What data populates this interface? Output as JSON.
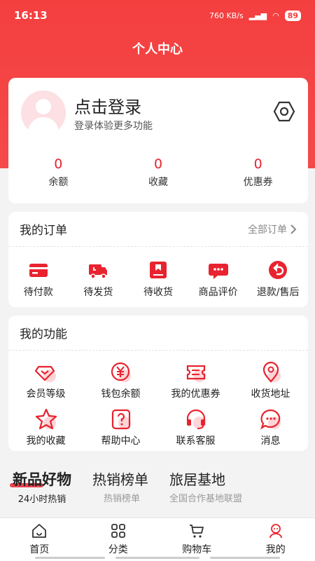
{
  "status_bar": {
    "time": "16:13",
    "net_speed": "760 KB/s",
    "battery": "89"
  },
  "page_title": "个人中心",
  "profile": {
    "login_title": "点击登录",
    "login_subtitle": "登录体验更多功能",
    "stats": [
      {
        "value": "0",
        "label": "余额"
      },
      {
        "value": "0",
        "label": "收藏"
      },
      {
        "value": "0",
        "label": "优惠券"
      }
    ]
  },
  "orders": {
    "title": "我的订单",
    "more": "全部订单",
    "items": [
      {
        "label": "待付款",
        "icon": "card-icon"
      },
      {
        "label": "待发货",
        "icon": "truck-icon"
      },
      {
        "label": "待收货",
        "icon": "box-icon"
      },
      {
        "label": "商品评价",
        "icon": "comment-icon"
      },
      {
        "label": "退款/售后",
        "icon": "return-icon"
      }
    ]
  },
  "functions": {
    "title": "我的功能",
    "items": [
      {
        "label": "会员等级",
        "icon": "diamond-icon"
      },
      {
        "label": "钱包余额",
        "icon": "yen-icon"
      },
      {
        "label": "我的优惠券",
        "icon": "coupon-icon"
      },
      {
        "label": "收货地址",
        "icon": "location-icon"
      },
      {
        "label": "我的收藏",
        "icon": "star-icon"
      },
      {
        "label": "帮助中心",
        "icon": "help-icon"
      },
      {
        "label": "联系客服",
        "icon": "headset-icon"
      },
      {
        "label": "消息",
        "icon": "message-icon"
      }
    ]
  },
  "tabs": [
    {
      "title": "新品好物",
      "subtitle": "24小时热销"
    },
    {
      "title": "热销榜单",
      "subtitle": "热销榜单"
    },
    {
      "title": "旅居基地",
      "subtitle": "全国合作基地联盟"
    }
  ],
  "bottom_nav": [
    {
      "label": "首页",
      "icon": "home-icon"
    },
    {
      "label": "分类",
      "icon": "grid-icon"
    },
    {
      "label": "购物车",
      "icon": "cart-icon"
    },
    {
      "label": "我的",
      "icon": "user-icon"
    }
  ],
  "colors": {
    "accent": "#e8232f",
    "header": "#f43f3f"
  }
}
